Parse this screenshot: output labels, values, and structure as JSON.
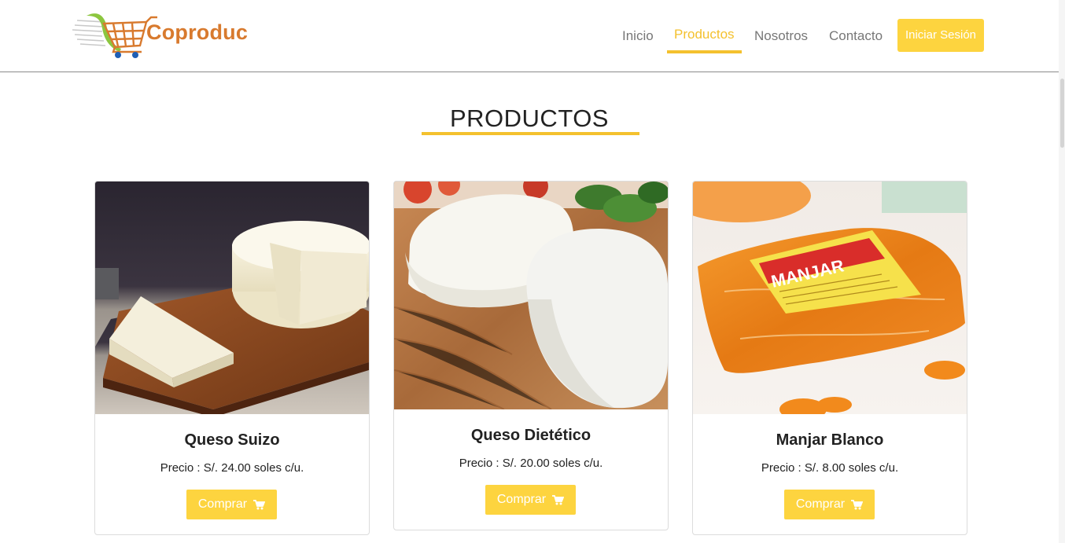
{
  "brand": {
    "name": "Coproduc",
    "colors": {
      "accent": "#f4c12e",
      "button": "#fdd43f",
      "logo_text": "#d87a2e",
      "nav_text": "#777777"
    }
  },
  "nav": {
    "items": [
      {
        "label": "Inicio",
        "active": false
      },
      {
        "label": "Productos",
        "active": true
      },
      {
        "label": "Nosotros",
        "active": false
      },
      {
        "label": "Contacto",
        "active": false
      }
    ],
    "login_label": "Iniciar Sesión"
  },
  "section": {
    "title": "PRODUCTOS"
  },
  "products": [
    {
      "name": "Queso Suizo",
      "price": "Precio :  S/. 24.00 soles c/u.",
      "buy_label": "Comprar",
      "image": "cheese-wheel-on-cutting-board"
    },
    {
      "name": "Queso Dietético",
      "price": "Precio :  S/. 20.00 soles c/u.",
      "buy_label": "Comprar",
      "image": "fresh-white-cheese-on-board"
    },
    {
      "name": "Manjar Blanco",
      "price": "Precio :  S/. 8.00 soles c/u.",
      "buy_label": "Comprar",
      "image": "manjar-bag-with-label"
    }
  ],
  "manjar_label": "MANJAR",
  "icons": {
    "cart": "shopping-cart-icon",
    "logo": "shopping-cart-logo"
  }
}
